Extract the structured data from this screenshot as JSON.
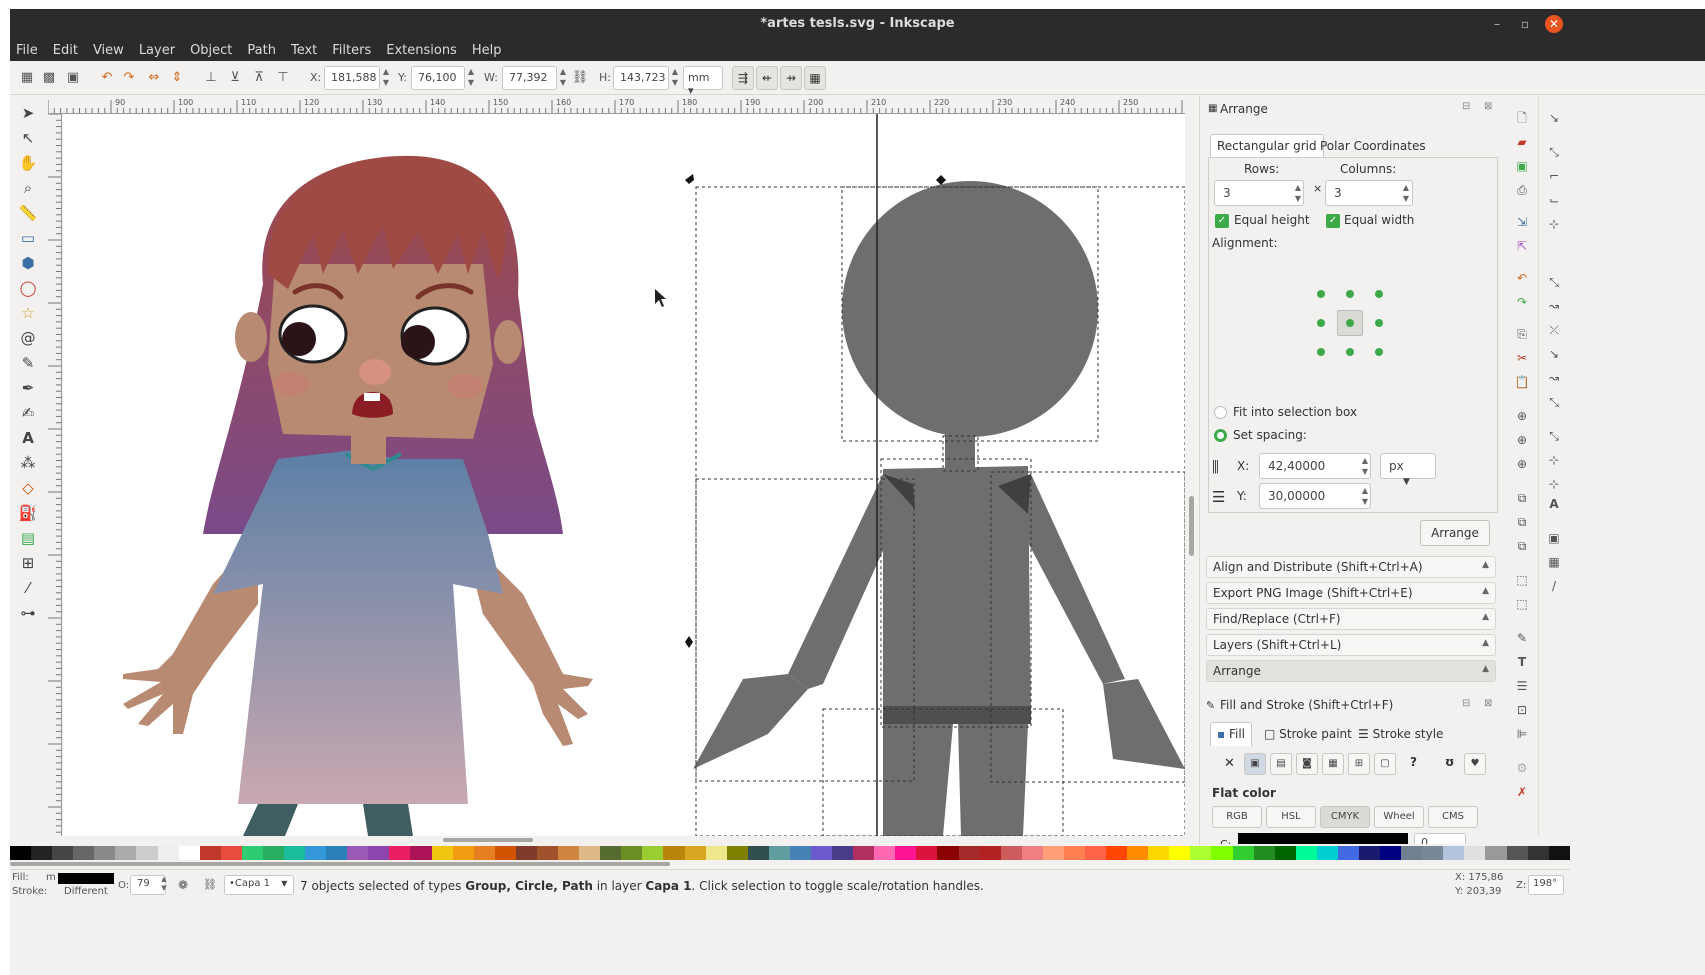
{
  "window": {
    "title": "*artes tesls.svg - Inkscape"
  },
  "menu": [
    "File",
    "Edit",
    "View",
    "Layer",
    "Object",
    "Path",
    "Text",
    "Filters",
    "Extensions",
    "Help"
  ],
  "toolcontrols": {
    "x_label": "X:",
    "x_value": "181,588",
    "y_label": "Y:",
    "y_value": "76,100",
    "w_label": "W:",
    "w_value": "77,392",
    "h_label": "H:",
    "h_value": "143,723",
    "unit": "mm"
  },
  "ruler": {
    "ticks": [
      "90",
      "100",
      "110",
      "120",
      "130",
      "140",
      "150",
      "160",
      "170",
      "180",
      "190",
      "200",
      "210",
      "220",
      "230",
      "240",
      "250"
    ]
  },
  "arrange": {
    "title": "Arrange",
    "tabs": [
      "Rectangular grid",
      "Polar Coordinates"
    ],
    "rows_label": "Rows:",
    "rows_value": "3",
    "columns_label": "Columns:",
    "columns_value": "3",
    "times": "×",
    "equal_height": "Equal height",
    "equal_width": "Equal width",
    "alignment_label": "Alignment:",
    "fit_selection": "Fit into selection box",
    "set_spacing": "Set spacing:",
    "x_label": "X:",
    "x_value": "42,40000",
    "y_label": "Y:",
    "y_value": "30,00000",
    "unit": "px",
    "arrange_button": "Arrange"
  },
  "docked_panels": [
    "Align and Distribute (Shift+Ctrl+A)",
    "Export PNG Image (Shift+Ctrl+E)",
    "Find/Replace (Ctrl+F)",
    "Layers (Shift+Ctrl+L)",
    "Arrange"
  ],
  "fillstroke": {
    "title": "Fill and Stroke (Shift+Ctrl+F)",
    "tabs": [
      "Fill",
      "Stroke paint",
      "Stroke style"
    ],
    "mode": "Flat color",
    "color_modes": [
      "RGB",
      "HSL",
      "CMYK",
      "Wheel",
      "CMS"
    ],
    "c_label": "C:",
    "c_value": "0"
  },
  "statusbar": {
    "fill_label": "Fill:",
    "fill_value": "m",
    "stroke_label": "Stroke:",
    "stroke_value": "Different",
    "opacity_label": "O:",
    "opacity_value": "79",
    "layer": "•Capa 1",
    "message_prefix": "7 objects selected of types ",
    "types": "Group, Circle, Path",
    "message_mid": " in layer ",
    "layer_name": "Capa 1",
    "message_suffix": ". Click selection to toggle scale/rotation handles.",
    "x_coord": "X: 175,86",
    "y_coord": "Y: 203,39",
    "zoom_label": "Z:",
    "zoom_value": "198°"
  },
  "colors": {
    "hair": "#a04a44",
    "skin": "#b88a72",
    "dress_top": "#5b7fa6",
    "dress_bottom": "#c9a8b0",
    "legs": "#3f5e62",
    "figure_gray": "#6d6e6f",
    "accent_green": "#3daa4a",
    "chrome_dark": "#2b2b2b"
  },
  "icons": {
    "tools": [
      "selector-icon",
      "node-icon",
      "tweak-icon",
      "zoom-icon",
      "measure-icon",
      "rect-icon",
      "3dbox-icon",
      "ellipse-icon",
      "star-icon",
      "spiral-icon",
      "pencil-icon",
      "pen-icon",
      "calligraphy-icon",
      "text-icon",
      "spray-icon",
      "eraser-icon",
      "bucket-icon",
      "gradient-icon",
      "mesh-icon",
      "dropper-icon",
      "connector-icon"
    ]
  }
}
